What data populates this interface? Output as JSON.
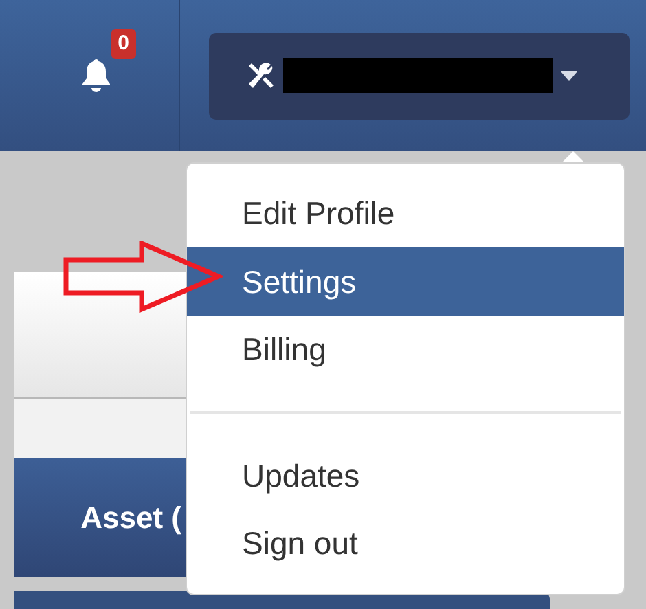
{
  "navbar": {
    "notifications": {
      "count": "0"
    },
    "user_menu": {
      "expanded": true
    }
  },
  "content": {
    "panel_heading": "Asset ("
  },
  "dropdown": {
    "items": [
      {
        "kind": "item",
        "label": "Edit Profile",
        "selected": false
      },
      {
        "kind": "item",
        "label": "Settings",
        "selected": true
      },
      {
        "kind": "item",
        "label": "Billing",
        "selected": false
      },
      {
        "kind": "divider"
      },
      {
        "kind": "item",
        "label": "Updates",
        "selected": false
      },
      {
        "kind": "item",
        "label": "Sign out",
        "selected": false
      }
    ]
  }
}
